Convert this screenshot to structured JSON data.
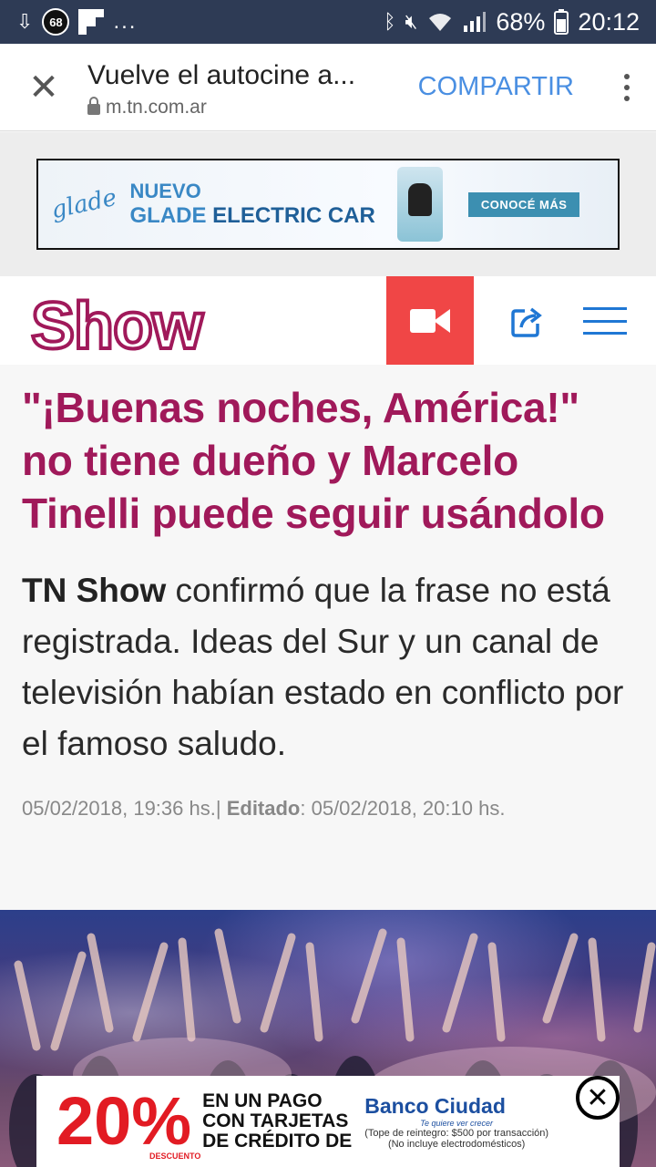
{
  "status_bar": {
    "notification_badge": "68",
    "overflow": "...",
    "battery": "68%",
    "time": "20:12"
  },
  "tab_bar": {
    "close_glyph": "✕",
    "title": "Vuelve el autocine a...",
    "url": "m.tn.com.ar",
    "share_label": "COMPARTIR"
  },
  "ad_top": {
    "brand": "glade",
    "line1": "NUEVO",
    "line2_brand": "GLADE",
    "line2_rest": "ELECTRIC CAR",
    "cta": "CONOCÉ MÁS"
  },
  "site_header": {
    "logo": "Show"
  },
  "article": {
    "headline": "\"¡Buenas noches, América!\" no tiene dueño y Marcelo Tinelli puede seguir usándolo",
    "lede_bold": "TN Show",
    "lede_rest": " confirmó que la frase no está registrada. Ideas del Sur y un canal de televisión habían estado en conflicto por el famoso saludo.",
    "published": "05/02/2018, 19:36 hs.",
    "separator": "|",
    "edited_label": "Editado",
    "edited": ": 05/02/2018, 20:10 hs."
  },
  "ad_bottom": {
    "percent": "20%",
    "percent_sub": "DESCUENTO",
    "promo_l1": "EN UN PAGO",
    "promo_l2": "CON TARJETAS",
    "promo_l3": "DE CRÉDITO DE",
    "bank": "Banco Ciudad",
    "slogan": "Te quiere ver crecer",
    "note_l1": "(Tope de reintegro: $500 por transacción)",
    "note_l2": "(No incluye electrodomésticos)",
    "close_glyph": "✕"
  },
  "colors": {
    "status_bar": "#2e3b55",
    "accent_link": "#4a8fe2",
    "brand_magenta": "#a0195a",
    "video_button": "#f04646",
    "nav_blue": "#1f77d4"
  }
}
